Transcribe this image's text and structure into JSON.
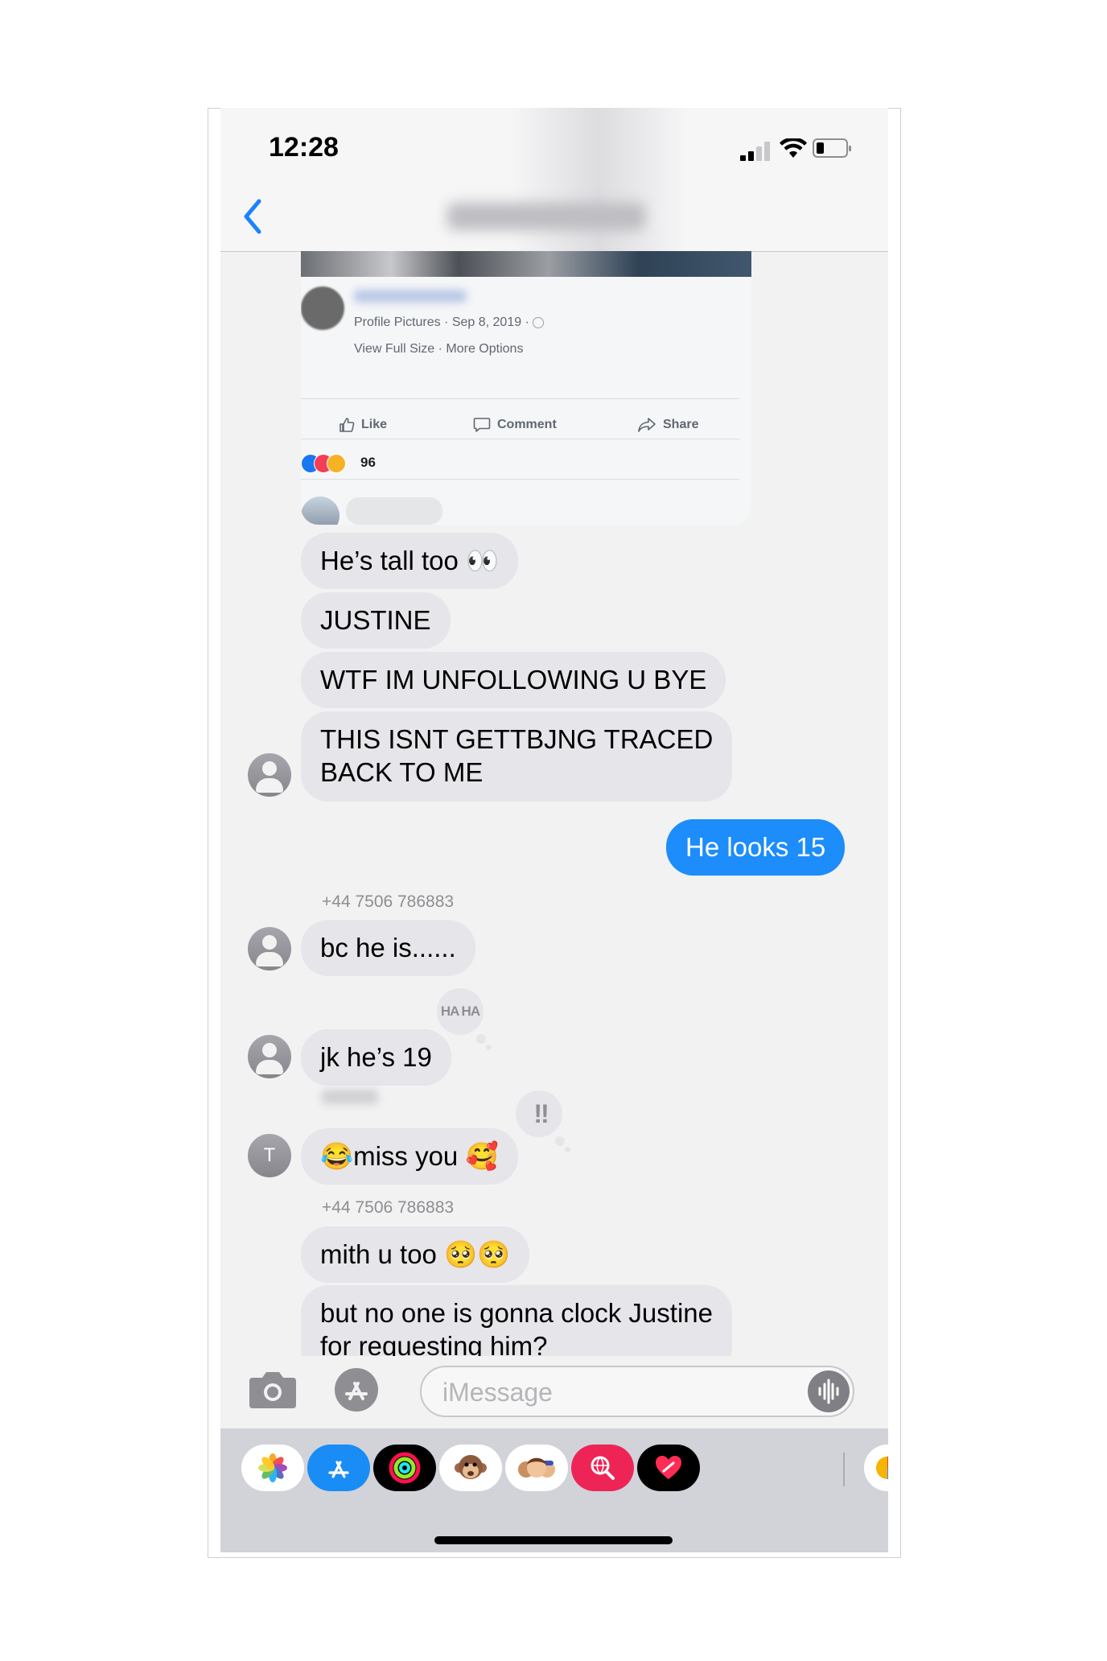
{
  "status_bar": {
    "time": "12:28"
  },
  "fb_embed": {
    "meta": "Profile Pictures · Sep 8, 2019 · ",
    "links": "View Full Size · More Options",
    "actions": {
      "like": "Like",
      "comment": "Comment",
      "share": "Share"
    },
    "reaction_count": "96"
  },
  "messages": [
    {
      "text": "He’s tall too 👀",
      "direction": "received"
    },
    {
      "text": "JUSTINE",
      "direction": "received"
    },
    {
      "text": "WTF IM UNFOLLOWING U BYE",
      "direction": "received"
    },
    {
      "line1": "THIS ISNT GETTBJNG TRACED",
      "line2": "BACK TO ME",
      "direction": "received"
    },
    {
      "text": "He looks 15",
      "direction": "sent"
    },
    {
      "sender": "+44 7506 786883",
      "text": "bc he is......",
      "direction": "received"
    },
    {
      "text": "jk he’s 19",
      "direction": "received",
      "tapback": "HA HA"
    },
    {
      "text": "😂miss you 🥰",
      "direction": "received",
      "tapback": "‼",
      "avatar_letter": "T"
    },
    {
      "sender": "+44 7506 786883",
      "text": "mith u too 🥺🥺",
      "direction": "received"
    },
    {
      "line1": "but no one is gonna clock Justine",
      "line2": "for requesting him?",
      "direction": "received"
    }
  ],
  "input": {
    "placeholder": "iMessage"
  },
  "app_drawer": {
    "icons": [
      "photos-icon",
      "app-store-icon",
      "activity-icon",
      "animoji-icon",
      "memoji-icon",
      "image-search-icon",
      "digital-touch-icon",
      "music-icon"
    ]
  },
  "colors": {
    "sent_bubble": "#1c8dfb",
    "received_bubble": "#e5e5ea",
    "accent": "#1a82fb"
  }
}
